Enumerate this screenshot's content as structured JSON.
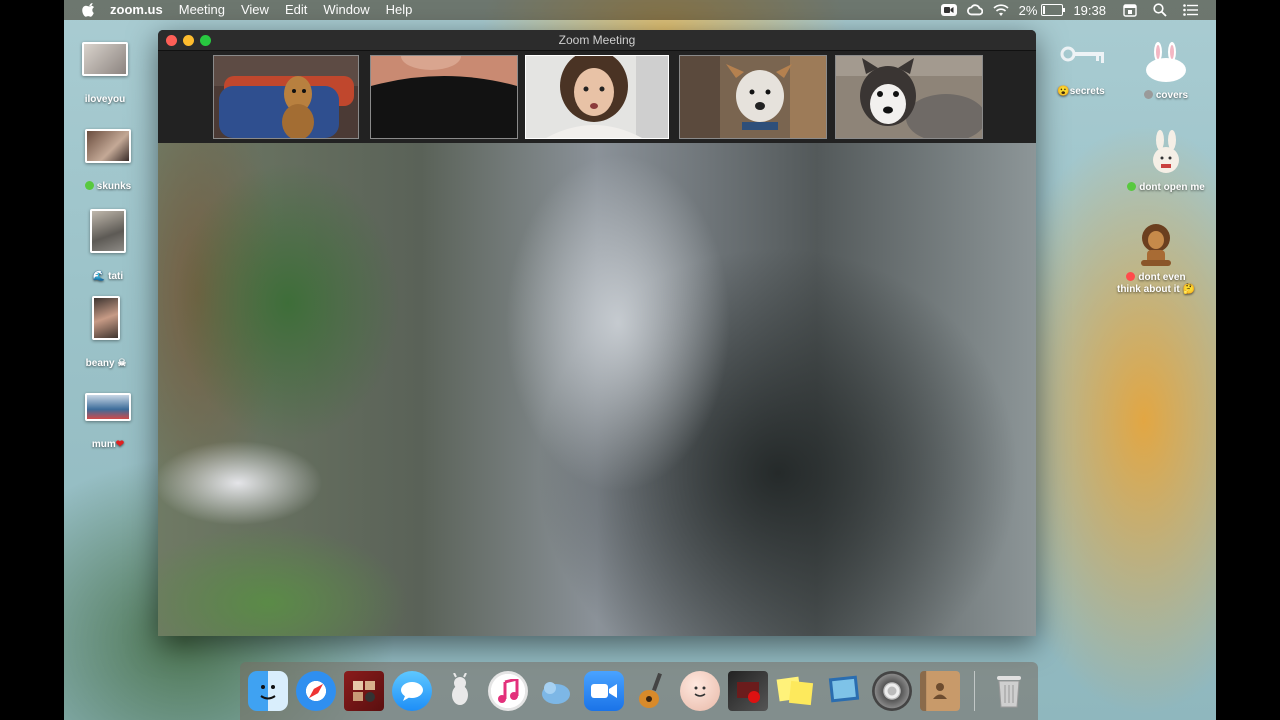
{
  "menubar": {
    "app_name": "zoom.us",
    "menus": [
      "Meeting",
      "View",
      "Edit",
      "Window",
      "Help"
    ],
    "battery": "2%",
    "clock": "19:38"
  },
  "desktop": {
    "left_icons": [
      {
        "label": "iloveyou",
        "tag_color": ""
      },
      {
        "label": "skunks",
        "tag_color": "#58c93f"
      },
      {
        "label": "tati",
        "tag_color": ""
      },
      {
        "label": "beany",
        "tag_color": ""
      },
      {
        "label": "mum",
        "tag_color": ""
      }
    ],
    "right_icons": [
      {
        "label": "secrets",
        "tag_color": ""
      },
      {
        "label": "covers",
        "tag_color": "#9a9a9a"
      },
      {
        "label": "dont open me",
        "tag_color": "#58c93f"
      },
      {
        "label": "dont even think about it",
        "tag_color": "#ff4b4b"
      }
    ]
  },
  "zoom": {
    "window_title": "Zoom Meeting"
  },
  "colors": {
    "close": "#ff5f57",
    "minimize": "#febc2e",
    "maximize": "#28c840"
  },
  "dock": {
    "apps": [
      "finder-icon",
      "safari-icon",
      "photo-booth-icon",
      "messages-icon",
      "inkscape-icon",
      "itunes-icon",
      "sequel-pro-icon",
      "zoom-icon",
      "garageband-icon",
      "face-app-icon",
      "photo-booth-2-icon",
      "stickies-icon",
      "preview-icon",
      "system-preferences-icon",
      "contacts-icon",
      "trash-icon"
    ]
  }
}
